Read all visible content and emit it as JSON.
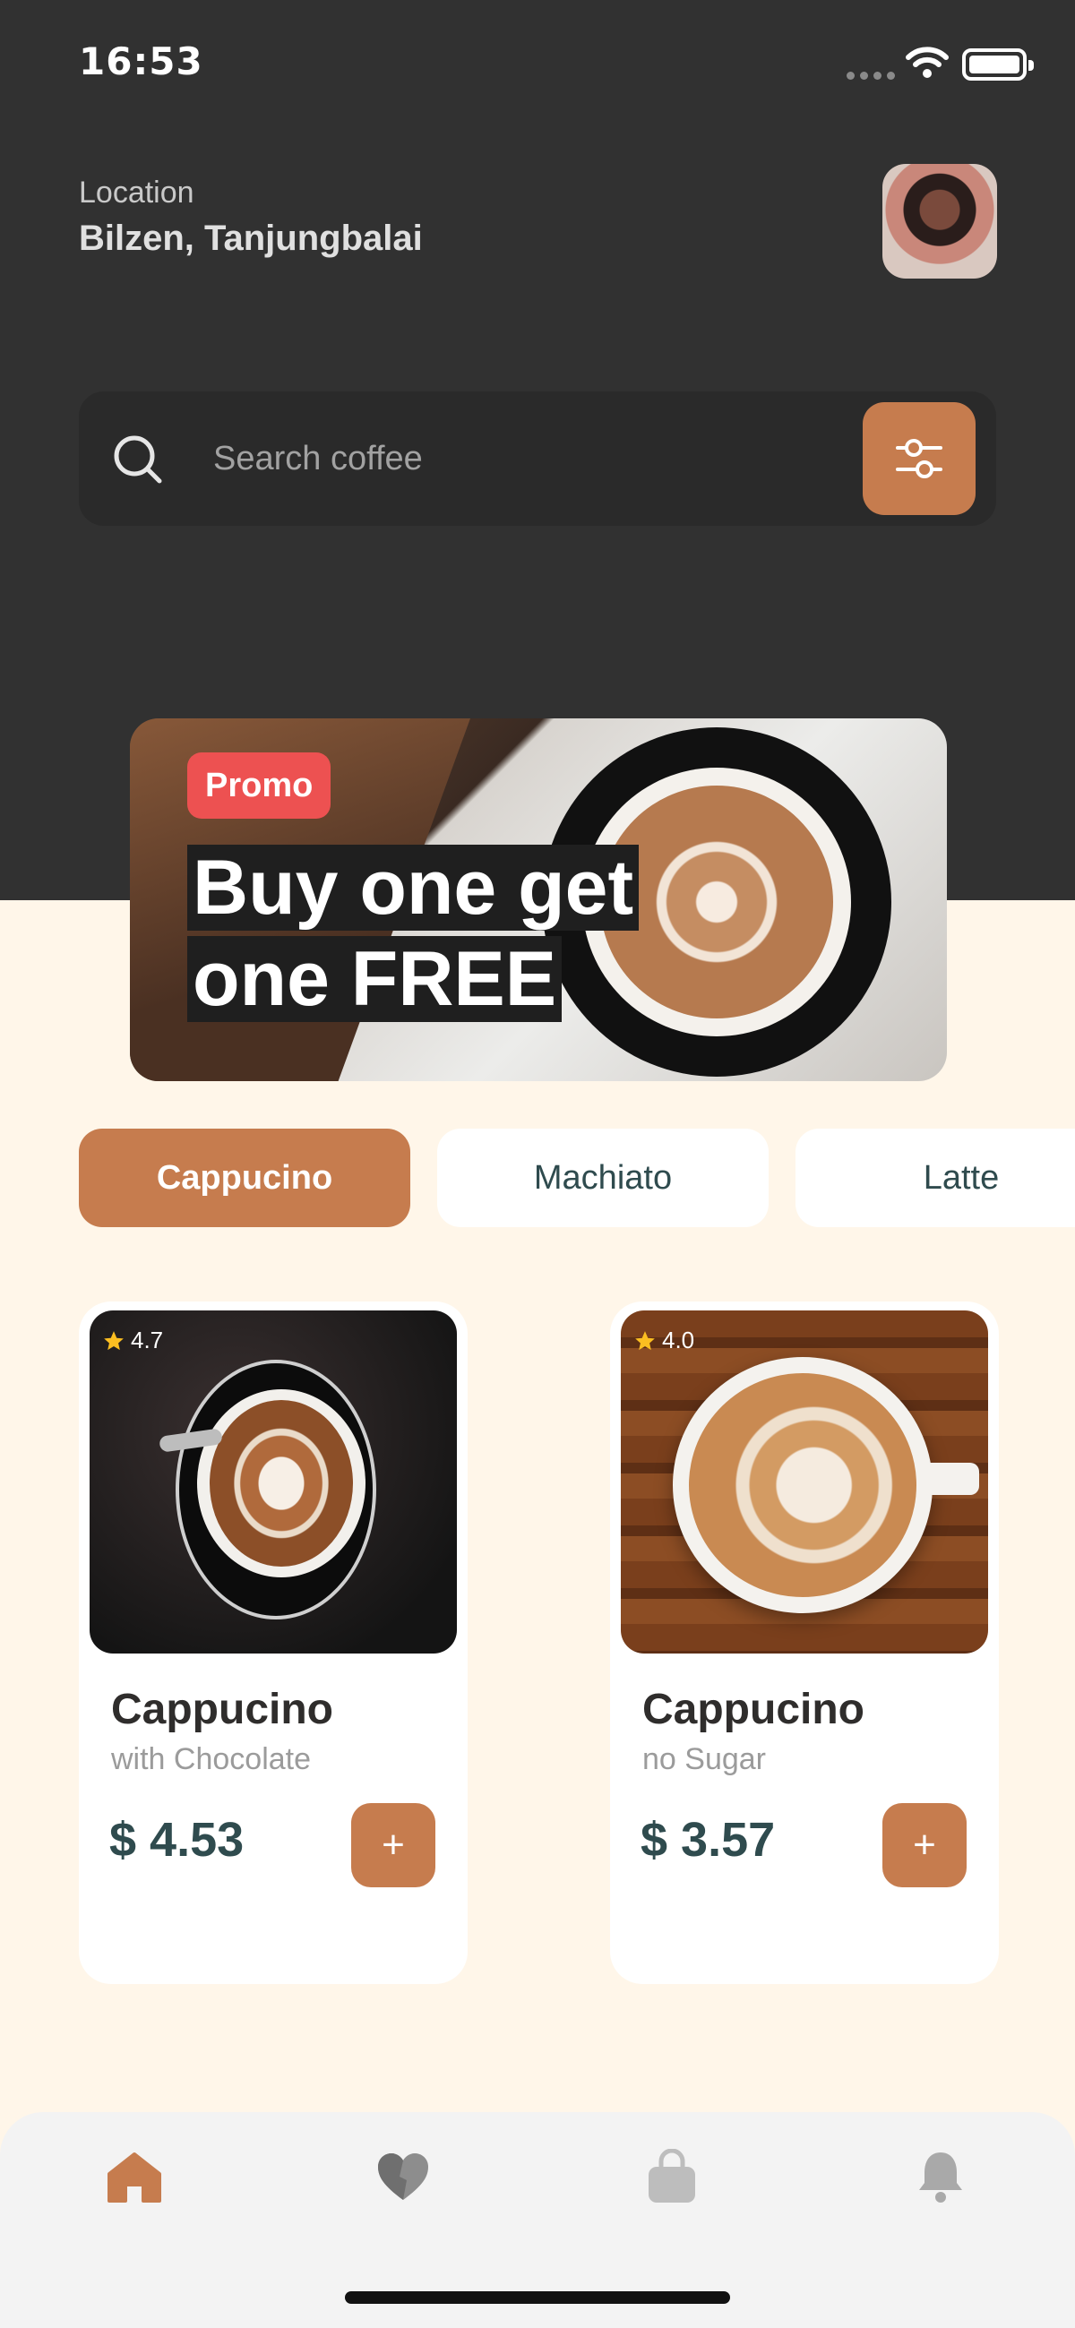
{
  "status_bar": {
    "time": "16:53"
  },
  "header": {
    "location_label": "Location",
    "location_value": "Bilzen, Tanjungbalai"
  },
  "search": {
    "placeholder": "Search coffee"
  },
  "promo": {
    "badge": "Promo",
    "line1": "Buy one get",
    "line2": "one FREE"
  },
  "categories": [
    {
      "label": "Cappucino",
      "active": true
    },
    {
      "label": "Machiato",
      "active": false
    },
    {
      "label": "Latte",
      "active": false
    }
  ],
  "products": [
    {
      "rating": "4.7",
      "name": "Cappucino",
      "subtitle": "with Chocolate",
      "price": "$ 4.53",
      "add_label": "+"
    },
    {
      "rating": "4.0",
      "name": "Cappucino",
      "subtitle": "no Sugar",
      "price": "$ 3.57",
      "add_label": "+"
    }
  ],
  "nav": {
    "items": [
      {
        "icon": "home-icon",
        "active": true
      },
      {
        "icon": "heart-icon",
        "active": false
      },
      {
        "icon": "bag-icon",
        "active": false
      },
      {
        "icon": "bell-icon",
        "active": false
      }
    ]
  },
  "colors": {
    "accent": "#C67C4E",
    "dark_header": "#313131",
    "background": "#FFF6E9",
    "promo_badge": "#ED5151",
    "price_text": "#2F4B4E"
  }
}
